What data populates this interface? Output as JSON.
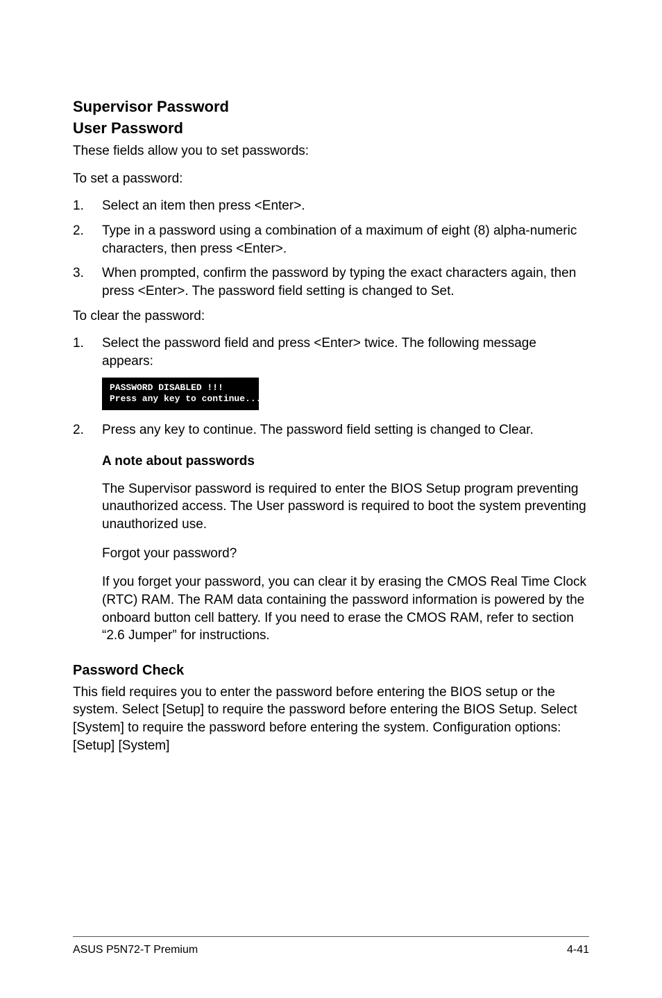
{
  "headings": {
    "h2a": "Supervisor Password",
    "h2b": "User Password",
    "h3": "Password Check"
  },
  "paragraphs": {
    "intro": "These fields allow you to set passwords:",
    "toSet": "To set a password:",
    "toClear": "To clear the password:",
    "check": "This field requires you to enter the password before entering the BIOS setup or the system. Select [Setup] to require the password before entering the BIOS Setup. Select [System] to require the password before entering the system. Configuration options: [Setup] [System]"
  },
  "setSteps": [
    {
      "num": "1.",
      "txt": "Select an item then press <Enter>."
    },
    {
      "num": "2.",
      "txt": "Type in a password using a combination of a maximum of eight (8) alpha-numeric characters, then press <Enter>."
    },
    {
      "num": "3.",
      "txt": "When prompted, confirm the password by typing the exact characters again, then press <Enter>. The password field setting is changed to Set."
    }
  ],
  "clearSteps1": [
    {
      "num": "1.",
      "txt": "Select the password field and press <Enter> twice. The following message appears:"
    }
  ],
  "codeBox": {
    "line1": "PASSWORD DISABLED !!!",
    "line2": "Press any key to continue..."
  },
  "clearSteps2": [
    {
      "num": "2.",
      "txt": "Press any key to continue. The password field setting is changed to Clear."
    }
  ],
  "note": {
    "title": "A note about passwords",
    "p1": "The Supervisor password is required to enter the BIOS Setup program preventing unauthorized access. The User password is required to boot the system preventing unauthorized use.",
    "p2": "Forgot your password?",
    "p3": "If you forget your password, you can clear it by erasing the CMOS Real Time Clock (RTC) RAM. The RAM data containing the password information is powered by the onboard button cell battery. If you need to erase the CMOS RAM, refer to section “2.6 Jumper” for instructions."
  },
  "footer": {
    "left": "ASUS P5N72-T Premium",
    "right": "4-41"
  }
}
